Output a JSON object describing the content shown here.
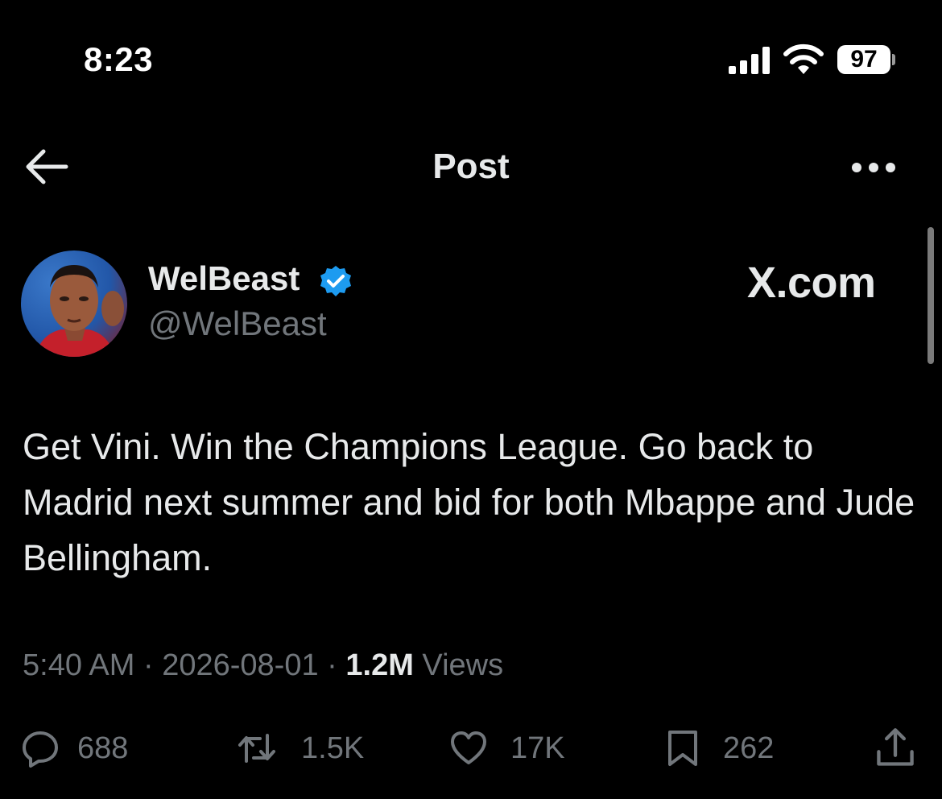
{
  "status_bar": {
    "time": "8:23",
    "battery": "97",
    "icons": [
      "signal-icon",
      "wifi-icon",
      "battery-icon"
    ]
  },
  "header": {
    "title": "Post",
    "back_icon": "arrow-left-icon",
    "more_icon": "more-horizontal-icon"
  },
  "author": {
    "name": "WelBeast",
    "handle": "@WelBeast",
    "verified": true,
    "watermark": "X.com"
  },
  "tweet": {
    "text": "Get Vini. Win the Champions League. Go back to Madrid next summer and bid for both Mbappe and Jude Bellingham."
  },
  "meta": {
    "time": "5:40 AM",
    "separator": "·",
    "date": "2026-08-01",
    "views_count": "1.2M",
    "views_label": "Views"
  },
  "actions": {
    "replies": "688",
    "reposts": "1.5K",
    "likes": "17K",
    "bookmarks": "262"
  },
  "colors": {
    "background": "#000000",
    "text": "#e7e9ea",
    "muted": "#71767b",
    "verified": "#1d9bf0"
  }
}
